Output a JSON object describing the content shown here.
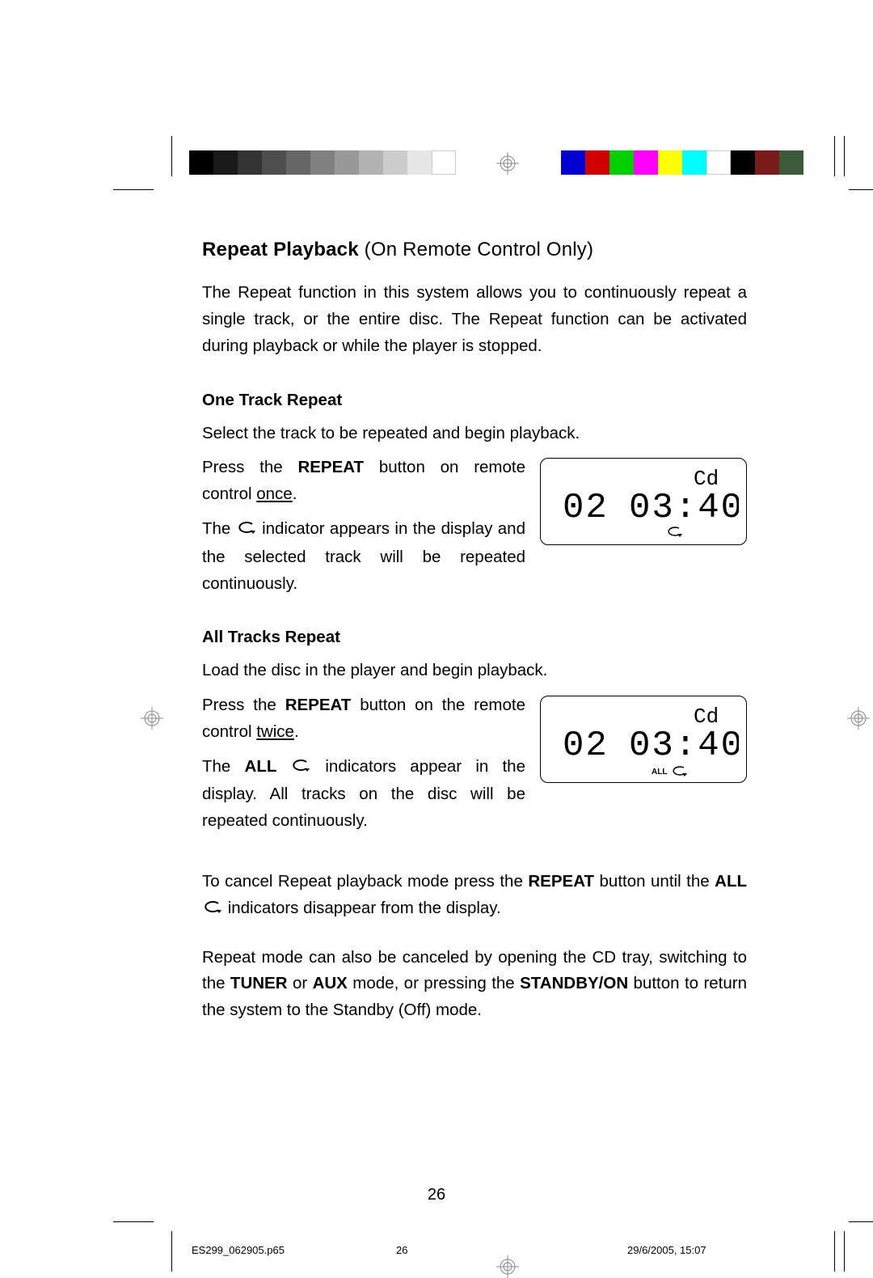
{
  "title_strong": "Repeat Playback",
  "title_rest": " (On Remote Control Only)",
  "intro_para": "The Repeat function in this system allows you to continuously repeat a single track, or the entire disc. The Repeat function can be activated during playback or while the player is stopped.",
  "one_track": {
    "heading": "One Track Repeat",
    "line1": "Select the track to be repeated and begin playback.",
    "line2_pre": "Press the ",
    "line2_bold": "REPEAT",
    "line2_post": " button on remote control ",
    "line2_uline": "once",
    "line3_pre": "The ",
    "line3_post": " indicator appears in the display and the selected track will be repeated continuously."
  },
  "all_tracks": {
    "heading": "All Tracks Repeat",
    "line1": "Load the disc in the player and begin playback.",
    "line2_pre": "Press the ",
    "line2_bold": "REPEAT",
    "line2_post": " button on the remote control ",
    "line2_uline": "twice",
    "line3_pre": "The ",
    "line3_bold": "ALL ",
    "line3_post": " indicators appear in the display. All tracks on the disc will be repeated continuously."
  },
  "cancel_para_pre": "To cancel Repeat playback mode press the ",
  "cancel_para_bold1": "REPEAT",
  "cancel_para_mid": " button until the ",
  "cancel_para_bold2": "ALL ",
  "cancel_para_post": " indicators disappear from the display.",
  "cancel2_pre": "Repeat mode can also be canceled by opening the CD tray, switching to the ",
  "cancel2_b1": "TUNER",
  "cancel2_mid1": " or ",
  "cancel2_b2": "AUX",
  "cancel2_mid2": " mode, or pressing the ",
  "cancel2_b3": "STANDBY/ON",
  "cancel2_post": " button to return the system to the Standby (Off) mode.",
  "lcd": {
    "cd_label": "Cd",
    "track": "02",
    "time": "03:40",
    "all_label": "ALL"
  },
  "page_number": "26",
  "footer": {
    "filename": "ES299_062905.p65",
    "page": "26",
    "timestamp": "29/6/2005, 15:07"
  }
}
